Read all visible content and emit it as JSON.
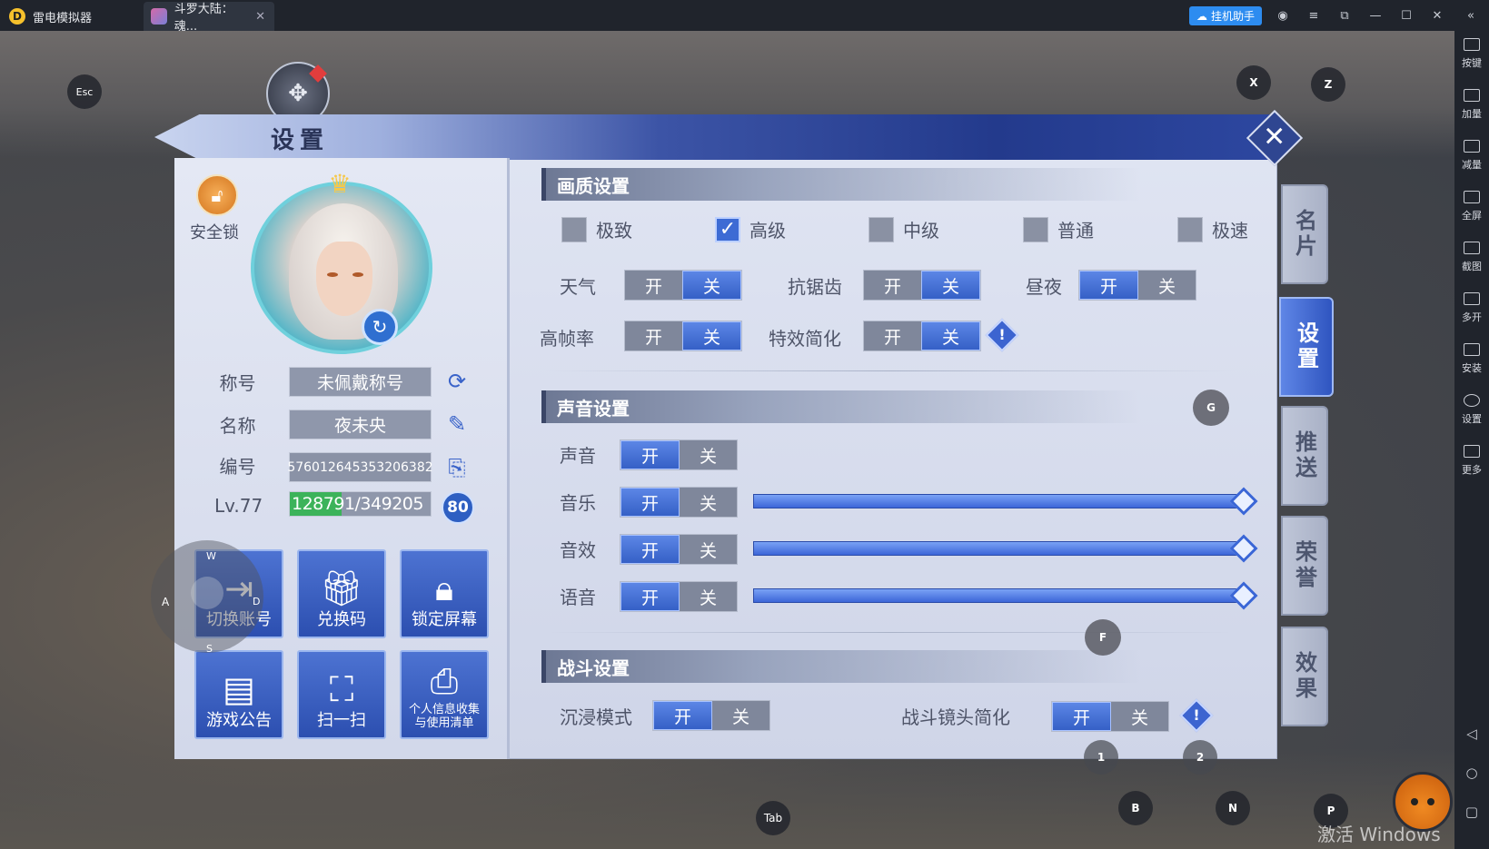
{
  "window": {
    "tabs": [
      {
        "label": "雷电模拟器"
      },
      {
        "label": "斗罗大陆：魂..."
      }
    ],
    "assistant_label": "挂机助手"
  },
  "sidebar": {
    "items": [
      {
        "label": "按键",
        "icon": "keyboard-icon"
      },
      {
        "label": "加量",
        "icon": "volume-up-icon"
      },
      {
        "label": "减量",
        "icon": "volume-down-icon"
      },
      {
        "label": "全屏",
        "icon": "fullscreen-icon"
      },
      {
        "label": "截图",
        "icon": "scissors-icon"
      },
      {
        "label": "多开",
        "icon": "multi-instance-icon"
      },
      {
        "label": "安装",
        "icon": "apk-icon"
      },
      {
        "label": "设置",
        "icon": "gear-icon"
      },
      {
        "label": "更多",
        "icon": "more-icon"
      }
    ]
  },
  "keymap": {
    "esc": "Esc",
    "x": "X",
    "z": "Z",
    "g": "G",
    "f": "F",
    "a": "A",
    "w": "W",
    "s": "S",
    "d": "D",
    "one": "1",
    "two": "2",
    "b": "B",
    "n": "N",
    "p": "P",
    "tab": "Tab"
  },
  "watermark": "激活 Windows",
  "settings": {
    "title": "设置",
    "close": "✕",
    "safety_lock": "安全锁",
    "profile": {
      "title_label": "称号",
      "title_value": "未佩戴称号",
      "name_label": "名称",
      "name_value": "夜未央",
      "id_label": "编号",
      "id_value": "576012645353206382",
      "level_label": "Lv.77",
      "exp_current": "128791",
      "exp_max": "/349205",
      "exp_fraction": 0.369,
      "level_badge": "80"
    },
    "actions": [
      {
        "label": "切换账号",
        "icon": "logout-icon"
      },
      {
        "label": "兑换码",
        "icon": "gift-icon"
      },
      {
        "label": "锁定屏幕",
        "icon": "lock-icon"
      },
      {
        "label": "游戏公告",
        "icon": "notice-board-icon"
      },
      {
        "label": "扫一扫",
        "icon": "scan-icon"
      },
      {
        "label": "个人信息收集\n与使用清单",
        "icon": "document-search-icon"
      }
    ],
    "graphics": {
      "header": "画质设置",
      "quality_options": [
        {
          "label": "极致",
          "checked": false
        },
        {
          "label": "高级",
          "checked": true
        },
        {
          "label": "中级",
          "checked": false
        },
        {
          "label": "普通",
          "checked": false
        },
        {
          "label": "极速",
          "checked": false
        }
      ],
      "weather": "天气",
      "antialias": "抗锯齿",
      "daynight": "昼夜",
      "high_fps": "高帧率",
      "effects_simplify": "特效简化"
    },
    "sound": {
      "header": "声音设置",
      "sound": "声音",
      "music": "音乐",
      "sfx": "音效",
      "voice": "语音",
      "music_level": 1.0,
      "sfx_level": 1.0,
      "voice_level": 1.0
    },
    "battle": {
      "header": "战斗设置",
      "immersive": "沉浸模式",
      "camera_simplify": "战斗镜头简化"
    },
    "toggle_on": "开",
    "toggle_off": "关",
    "info_mark": "!",
    "side_tabs": [
      {
        "label": "名片"
      },
      {
        "label": "设置"
      },
      {
        "label": "推送"
      },
      {
        "label": "荣誉"
      },
      {
        "label": "效果"
      }
    ]
  }
}
